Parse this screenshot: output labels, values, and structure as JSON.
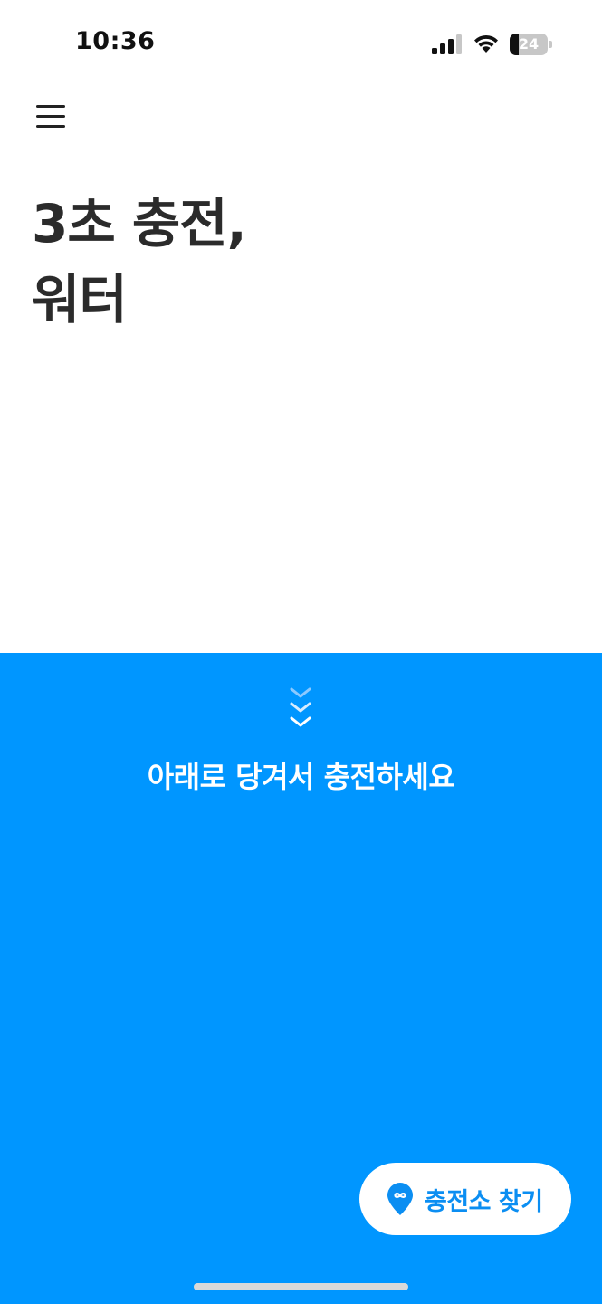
{
  "status_bar": {
    "time": "10:36",
    "battery_level": "24",
    "battery_fraction": 0.24,
    "icons": [
      "cellular-signal-icon",
      "wifi-icon",
      "battery-icon"
    ]
  },
  "header": {
    "menu_icon": "hamburger-menu-icon"
  },
  "headline": {
    "line1": "3초 충전,",
    "line2": "워터"
  },
  "charge_panel": {
    "pull_icon": "chevron-down-stack-icon",
    "pull_text": "아래로 당겨서 충전하세요",
    "find_station_icon": "location-pin-icon",
    "find_station_label": "충전소 찾기"
  },
  "colors": {
    "accent": "#0096ff",
    "button_text": "#0b8ef2",
    "headline_text": "#2b2b2b",
    "background": "#ffffff"
  }
}
